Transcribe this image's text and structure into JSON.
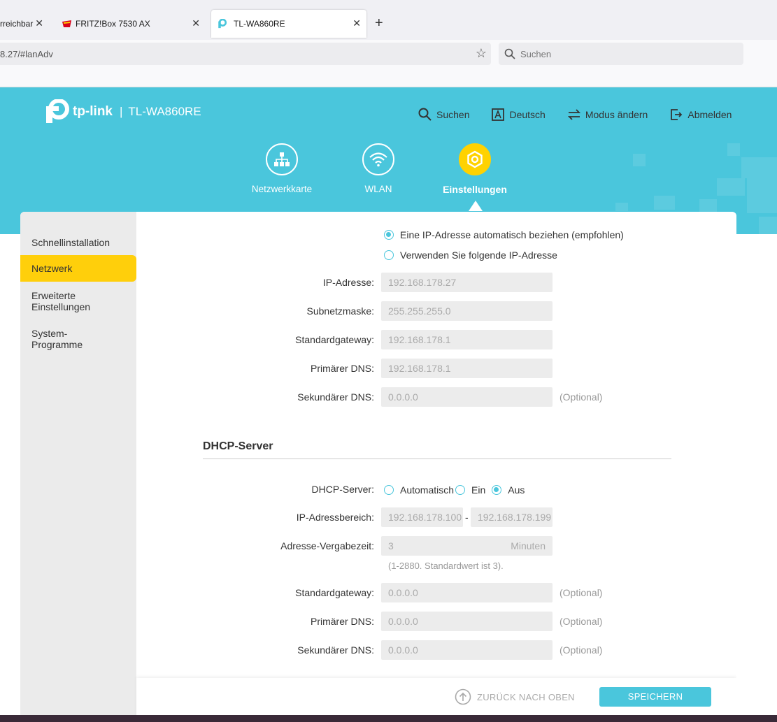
{
  "browser": {
    "tabs": [
      {
        "title": "rreichbar"
      },
      {
        "title": "FRITZ!Box 7530 AX"
      },
      {
        "title": "TL-WA860RE"
      }
    ],
    "url": "8.27/#lanAdv",
    "search_placeholder": "Suchen"
  },
  "header": {
    "brand": "tp-link",
    "separator": "|",
    "model": "TL-WA860RE",
    "links": {
      "search": "Suchen",
      "language": "Deutsch",
      "mode": "Modus ändern",
      "logout": "Abmelden"
    },
    "nav": [
      {
        "label": "Netzwerkkarte"
      },
      {
        "label": "WLAN"
      },
      {
        "label": "Einstellungen",
        "active": true
      }
    ]
  },
  "sidebar": {
    "items": [
      {
        "label": "Schnellinstallation"
      },
      {
        "label": "Netzwerk",
        "active": true
      },
      {
        "label_line1": "Erweiterte",
        "label_line2": "Einstellungen"
      },
      {
        "label_line1": "System-",
        "label_line2": "Programme"
      }
    ]
  },
  "ip_settings": {
    "option_auto": "Eine IP-Adresse automatisch beziehen (empfohlen)",
    "option_manual": "Verwenden Sie folgende IP-Adresse",
    "selected": "auto",
    "fields": {
      "ip": {
        "label": "IP-Adresse:",
        "value": "192.168.178.27"
      },
      "subnet": {
        "label": "Subnetzmaske:",
        "value": "255.255.255.0"
      },
      "gateway": {
        "label": "Standardgateway:",
        "value": "192.168.178.1"
      },
      "dns1": {
        "label": "Primärer DNS:",
        "value": "192.168.178.1"
      },
      "dns2": {
        "label": "Sekundärer DNS:",
        "value": "0.0.0.0",
        "note": "(Optional)"
      }
    }
  },
  "dhcp": {
    "title": "DHCP-Server",
    "server_label": "DHCP-Server:",
    "options": {
      "auto": "Automatisch",
      "on": "Ein",
      "off": "Aus"
    },
    "selected": "off",
    "range": {
      "label": "IP-Adressbereich:",
      "start": "192.168.178.100",
      "sep": "-",
      "end": "192.168.178.199"
    },
    "lease": {
      "label": "Adresse-Vergabezeit:",
      "value": "3",
      "unit": "Minuten",
      "hint": "(1-2880. Standardwert ist 3)."
    },
    "gateway": {
      "label": "Standardgateway:",
      "value": "0.0.0.0",
      "note": "(Optional)"
    },
    "dns1": {
      "label": "Primärer DNS:",
      "value": "0.0.0.0",
      "note": "(Optional)"
    },
    "dns2": {
      "label": "Sekundärer DNS:",
      "value": "0.0.0.0",
      "note": "(Optional)"
    }
  },
  "footer": {
    "back_to_top": "ZURÜCK NACH OBEN",
    "save": "SPEICHERN"
  }
}
